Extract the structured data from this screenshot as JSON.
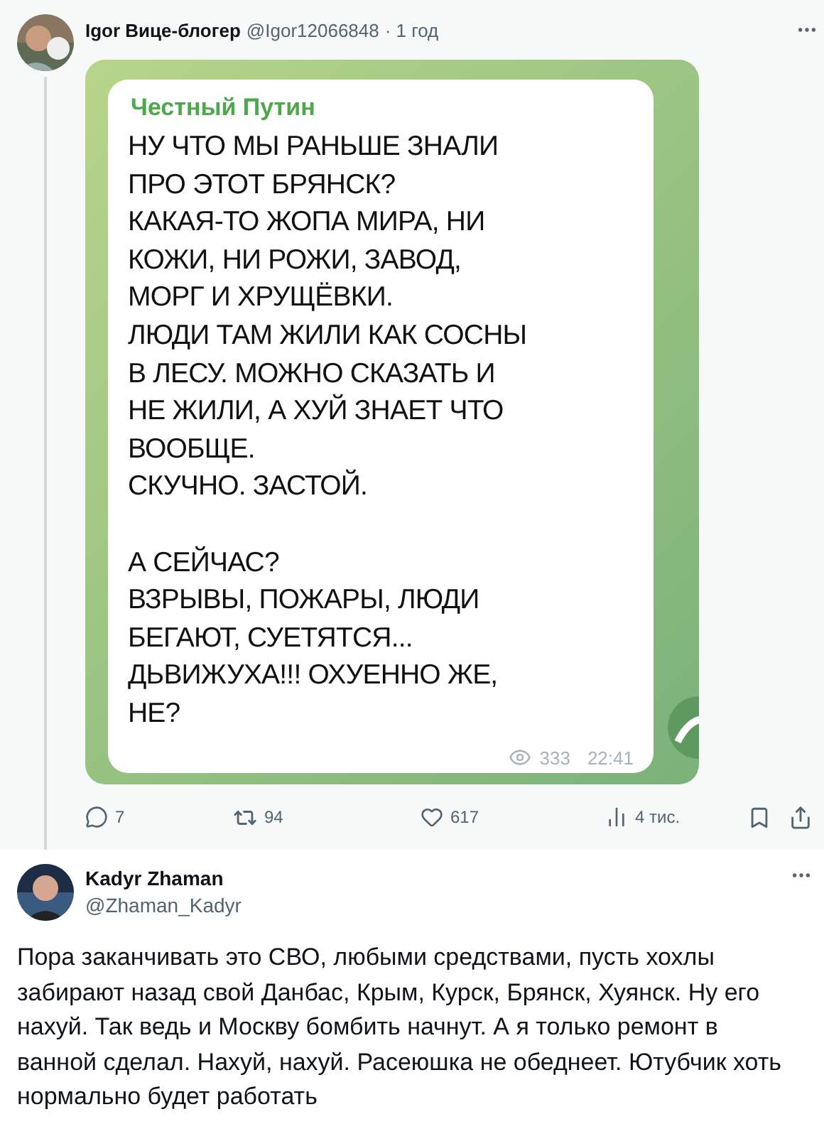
{
  "tweets": [
    {
      "name": "Igor Вице-блогер",
      "handle": "@Igor12066848",
      "time": "· 1 год",
      "thread_line": true,
      "media": {
        "kind": "picture",
        "channel": "Честный Путин",
        "message": "НУ ЧТО МЫ РАНЬШЕ ЗНАЛИ\nПРО ЭТОТ БРЯНСК?\nКАКАЯ-ТО ЖОПА МИРА, НИ\nКОЖИ, НИ РОЖИ, ЗАВОД,\nМОРГ И ХРУЩЁВКИ.\nЛЮДИ ТАМ ЖИЛИ КАК СОСНЫ\nВ ЛЕСУ. МОЖНО СКАЗАТЬ И\nНЕ ЖИЛИ, А ХУЙ ЗНАЕТ ЧТО\nВООБЩЕ.\nСКУЧНО. ЗАСТОЙ.\n\nА СЕЙЧАС?\nВЗРЫВЫ, ПОЖАРЫ, ЛЮДИ\nБЕГАЮТ, СУЕТЯТСЯ...\nДЬВИЖУХА!!! ОХУЕННО ЖЕ,\nНЕ?",
        "views": "333",
        "time": "22:41"
      },
      "actions": {
        "replies": "7",
        "reposts": "94",
        "likes": "617",
        "views": "4 тис."
      }
    },
    {
      "name": "Kadyr Zhaman",
      "handle": "@Zhaman_Kadyr",
      "thread_line": false,
      "text": "Пора заканчивать это СВО, любыми средствами, пусть хохлы забирают назад свой Данбас, Крым, Курск, Брянск, Хуянск. Ну его нахуй. Так ведь и Москву бомбить начнут. А я только ремонт в ванной сделал. Нахуй, нахуй. Расеюшка не обеднеет. Ютубчик хоть нормально будет работать"
    }
  ]
}
